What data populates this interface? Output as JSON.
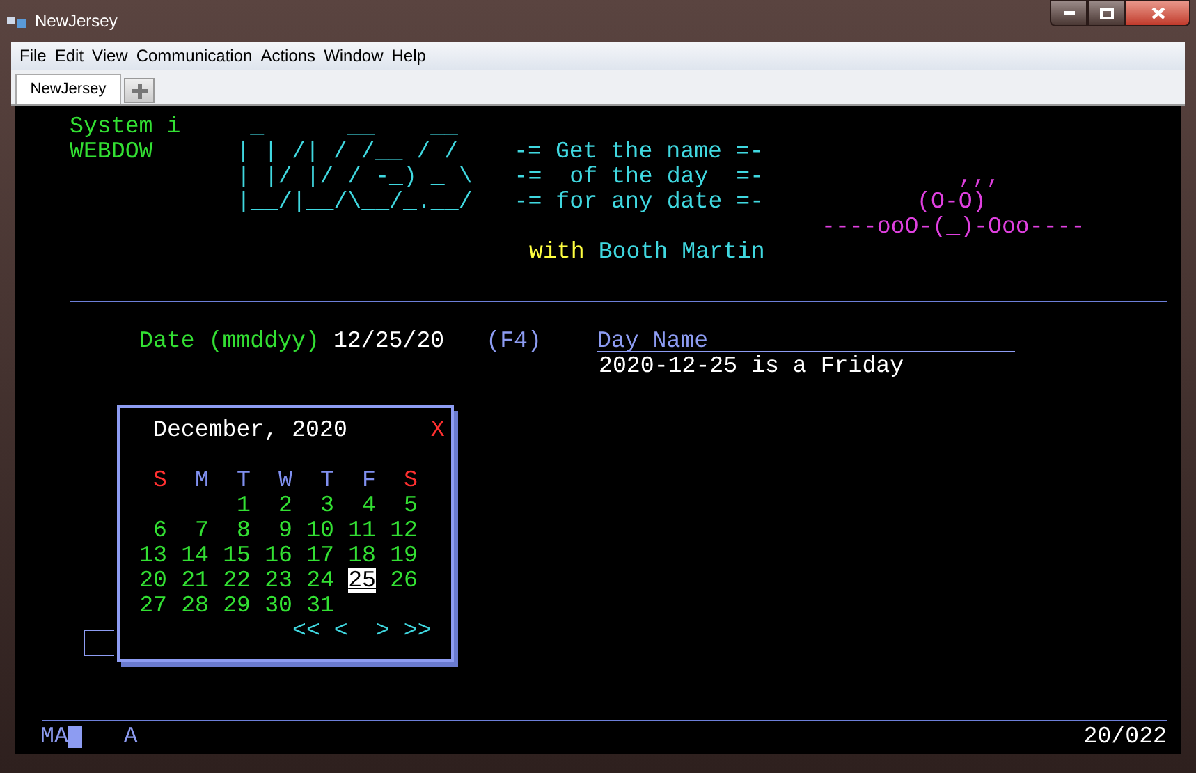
{
  "window": {
    "title": "NewJersey"
  },
  "menu": [
    "File",
    "Edit",
    "View",
    "Communication",
    "Actions",
    "Window",
    "Help"
  ],
  "tabs": [
    {
      "label": "NewJersey",
      "selected": true
    }
  ],
  "header": {
    "system": "System i",
    "app": "WEBDOW",
    "logo": [
      " _      __    __",
      "| | /| / /__ / /",
      "| |/ |/ / -_) _ \\",
      "|__/|__/\\__/_.__/"
    ],
    "tagline": [
      "-= Get the name =-",
      "-=  of the day  =-",
      "-= for any date =-"
    ],
    "mascot": [
      ",,,",
      "(O-O)",
      "----ooO-(_)-Ooo----"
    ],
    "byline_prefix": "with",
    "byline_name": "Booth Martin"
  },
  "form": {
    "date_label": "Date (mmddyy)",
    "date_value": "12/25/20",
    "prompt_key": "(F4)",
    "result_heading": "Day Name",
    "result": "2020-12-25 is a Friday"
  },
  "calendar": {
    "title": "December, 2020",
    "close": "X",
    "weekdays": [
      {
        "label": "S",
        "color": "#ff3030"
      },
      {
        "label": "M",
        "color": "#8090f0"
      },
      {
        "label": "T",
        "color": "#8090f0"
      },
      {
        "label": "W",
        "color": "#8090f0"
      },
      {
        "label": "T",
        "color": "#8090f0"
      },
      {
        "label": "F",
        "color": "#8090f0"
      },
      {
        "label": "S",
        "color": "#ff3030"
      }
    ],
    "weeks": [
      [
        {
          "day": "1",
          "selected": false
        },
        {
          "day": "2",
          "selected": false
        },
        {
          "day": "3",
          "selected": false
        },
        {
          "day": "4",
          "selected": false
        },
        {
          "day": "5",
          "selected": false
        }
      ],
      [
        {
          "day": "6",
          "selected": false
        },
        {
          "day": "7",
          "selected": false
        },
        {
          "day": "8",
          "selected": false
        },
        {
          "day": "9",
          "selected": false
        },
        {
          "day": "10",
          "selected": false
        },
        {
          "day": "11",
          "selected": false
        },
        {
          "day": "12",
          "selected": false
        }
      ],
      [
        {
          "day": "13",
          "selected": false
        },
        {
          "day": "14",
          "selected": false
        },
        {
          "day": "15",
          "selected": false
        },
        {
          "day": "16",
          "selected": false
        },
        {
          "day": "17",
          "selected": false
        },
        {
          "day": "18",
          "selected": false
        },
        {
          "day": "19",
          "selected": false
        }
      ],
      [
        {
          "day": "20",
          "selected": false
        },
        {
          "day": "21",
          "selected": false
        },
        {
          "day": "22",
          "selected": false
        },
        {
          "day": "23",
          "selected": false
        },
        {
          "day": "24",
          "selected": false
        },
        {
          "day": "25",
          "selected": true
        },
        {
          "day": "26",
          "selected": false
        }
      ],
      [
        {
          "day": "27",
          "selected": false
        },
        {
          "day": "28",
          "selected": false
        },
        {
          "day": "29",
          "selected": false
        },
        {
          "day": "30",
          "selected": false
        },
        {
          "day": "31",
          "selected": false
        }
      ]
    ],
    "nav": [
      "<<",
      "<",
      ">",
      ">>"
    ]
  },
  "status": {
    "mode": "MA",
    "field": "A",
    "position": "20/022"
  }
}
